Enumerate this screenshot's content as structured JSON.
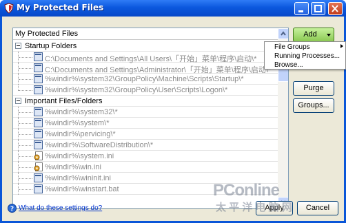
{
  "window": {
    "title": "My Protected Files"
  },
  "tree": {
    "header": "My Protected Files",
    "rows": [
      {
        "kind": "group",
        "text": "Startup Folders"
      },
      {
        "kind": "item",
        "icon": "folder-icon",
        "text": "C:\\Documents and Settings\\All Users\\「开始」菜单\\程序\\启动\\*"
      },
      {
        "kind": "item",
        "icon": "folder-icon",
        "text": "C:\\Documents and Settings\\Administrator\\「开始」菜单\\程序\\启动\\*"
      },
      {
        "kind": "item",
        "icon": "folder-icon",
        "text": "%windir%\\system32\\GroupPolicy\\Machine\\Scripts\\Startup\\*"
      },
      {
        "kind": "item",
        "icon": "folder-icon",
        "text": "%windir%\\system32\\GroupPolicy\\User\\Scripts\\Logon\\*"
      },
      {
        "kind": "group",
        "text": "Important Files/Folders"
      },
      {
        "kind": "item",
        "icon": "folder-icon",
        "text": "%windir%\\system32\\*"
      },
      {
        "kind": "item",
        "icon": "folder-icon",
        "text": "%windir%\\system\\*"
      },
      {
        "kind": "item",
        "icon": "folder-icon",
        "text": "%windir%\\pervicing\\*"
      },
      {
        "kind": "item",
        "icon": "folder-icon",
        "text": "%windir%\\SoftwareDistribution\\*"
      },
      {
        "kind": "item",
        "icon": "settings-file-icon",
        "text": "%windir%\\system.ini"
      },
      {
        "kind": "item",
        "icon": "settings-file-icon",
        "text": "%windir%\\win.ini"
      },
      {
        "kind": "item",
        "icon": "folder-icon",
        "text": "%windir%\\wininit.ini"
      },
      {
        "kind": "item",
        "icon": "folder-icon",
        "text": "%windir%\\winstart.bat"
      }
    ]
  },
  "buttons": {
    "add": "Add",
    "purge": "Purge",
    "groups": "Groups...",
    "apply": "Apply",
    "cancel": "Cancel"
  },
  "add_menu": {
    "items": [
      "File Groups",
      "Running Processes...",
      "Browse..."
    ]
  },
  "help": {
    "link": "What do these settings do?"
  },
  "watermark": {
    "brand": "PConline",
    "tagline": "太 平 洋 电 脑 网"
  },
  "colors": {
    "title_bar": "#0b58de",
    "add_button": "#8bc953",
    "link": "#0033cc",
    "item_text": "#8c8c8c"
  }
}
